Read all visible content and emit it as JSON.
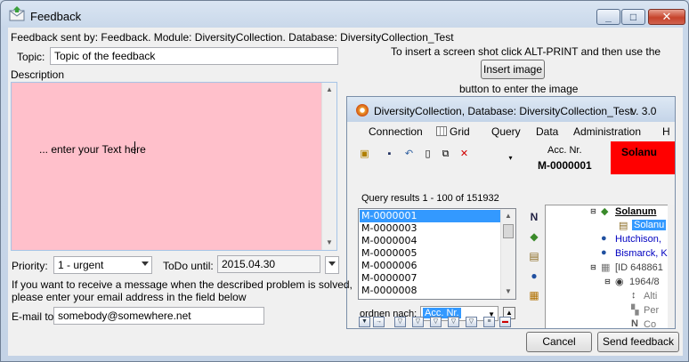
{
  "window": {
    "title": "Feedback",
    "icon": "envelope-icon",
    "controls": {
      "minimize": "minimize-icon",
      "maximize": "maximize-icon",
      "close": "close-icon"
    }
  },
  "info_line": "Feedback sent by: Feedback.   Module: DiversityCollection.   Database: DiversityCollection_Test",
  "topic": {
    "label": "Topic:",
    "value": "Topic of the feedback"
  },
  "description": {
    "label": "Description",
    "text": "... enter your Text here"
  },
  "screenshot_hint": {
    "line1": "To insert a screen shot click ALT-PRINT and then use the",
    "button": "Insert image",
    "line2": "button to enter the image"
  },
  "priority": {
    "label": "Priority:",
    "value": "1 - urgent"
  },
  "todo": {
    "label": "ToDo until:",
    "value": "2015.04.30"
  },
  "email_hint": {
    "line1": "If you want to receive a message when the described problem is solved,",
    "line2": "please enter your email address in the field below"
  },
  "email": {
    "label": "E-mail to:",
    "value": "somebody@somewhere.net"
  },
  "buttons": {
    "cancel": "Cancel",
    "send": "Send feedback"
  },
  "embedded": {
    "title": "DiversityCollection,  Database: DiversityCollection_Test",
    "version": "v. 3.0",
    "menu": [
      "Connection",
      "Grid",
      "Query",
      "Data",
      "Administration",
      "H"
    ],
    "acc_label": "Acc. Nr.",
    "acc_value": "M-0000001",
    "red_label": "Solanu",
    "query_results": "Query results   1 - 100 of 151932",
    "rows": [
      "M-0000001",
      "M-0000003",
      "M-0000004",
      "M-0000005",
      "M-0000006",
      "M-0000007",
      "M-0000008"
    ],
    "order_label": "ordnen nach:",
    "order_value": "Acc. Nr.",
    "tree": [
      "Solanum",
      "Solanu",
      "Hutchison,",
      "Bismarck, K",
      "[ID 648861",
      "1964/8",
      "Alti",
      "Per",
      "Co"
    ]
  },
  "colors": {
    "description_bg": "#ffc0cb",
    "selection": "#3399ff",
    "red_field": "#ff0000"
  }
}
